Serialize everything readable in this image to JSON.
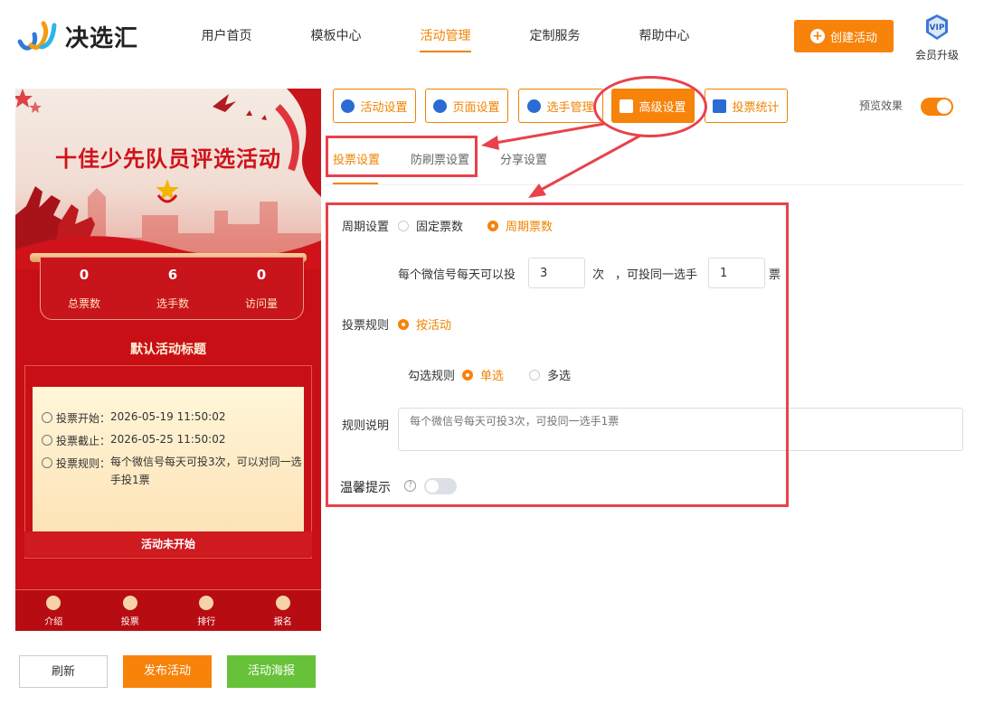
{
  "header": {
    "brand": "决选汇",
    "nav": [
      "用户首页",
      "模板中心",
      "活动管理",
      "定制服务",
      "帮助中心"
    ],
    "active_nav": "活动管理",
    "create_button": "创建活动",
    "vip_badge": "VIP",
    "vip_label": "会员升级"
  },
  "preview": {
    "banner_title": "十佳少先队员评选活动",
    "stats": [
      {
        "value": "0",
        "label": "总票数"
      },
      {
        "value": "6",
        "label": "选手数"
      },
      {
        "value": "0",
        "label": "访问量"
      }
    ],
    "activity_title": "默认活动标题",
    "info": [
      {
        "key": "投票开始：",
        "value": "2026-05-19 11:50:02"
      },
      {
        "key": "投票截止：",
        "value": "2026-05-25 11:50:02"
      },
      {
        "key": "投票规则：",
        "value": "每个微信号每天可投3次，可以对同一选手投1票"
      }
    ],
    "status": "活动未开始",
    "tabs": [
      "介绍",
      "投票",
      "排行",
      "报名"
    ]
  },
  "bottom_buttons": {
    "refresh": "刷新",
    "publish": "发布活动",
    "poster": "活动海报"
  },
  "toolbar": {
    "buttons": [
      "活动设置",
      "页面设置",
      "选手管理",
      "高级设置",
      "投票统计"
    ],
    "active": "高级设置",
    "preview_label": "预览效果"
  },
  "subtabs": [
    "投票设置",
    "防刷票设置",
    "分享设置"
  ],
  "form": {
    "period_label": "周期设置",
    "period_options": [
      "固定票数",
      "周期票数"
    ],
    "period_selected": "周期票数",
    "per_day_prefix": "每个微信号每天可以投",
    "per_day_value": "3",
    "per_day_unit": "次",
    "same_player_prefix": "，可投同一选手",
    "same_player_value": "1",
    "same_player_unit": "票",
    "rule_label": "投票规则",
    "rule_option": "按活动",
    "check_label": "勾选规则",
    "check_options": [
      "单选",
      "多选"
    ],
    "check_selected": "单选",
    "desc_label": "规则说明",
    "desc_placeholder": "每个微信号每天可投3次，可投同一选手1票",
    "tip_label": "温馨提示"
  },
  "colors": {
    "accent": "#f7830a",
    "highlight": "#e8424b",
    "poster_green": "#67c23a"
  }
}
